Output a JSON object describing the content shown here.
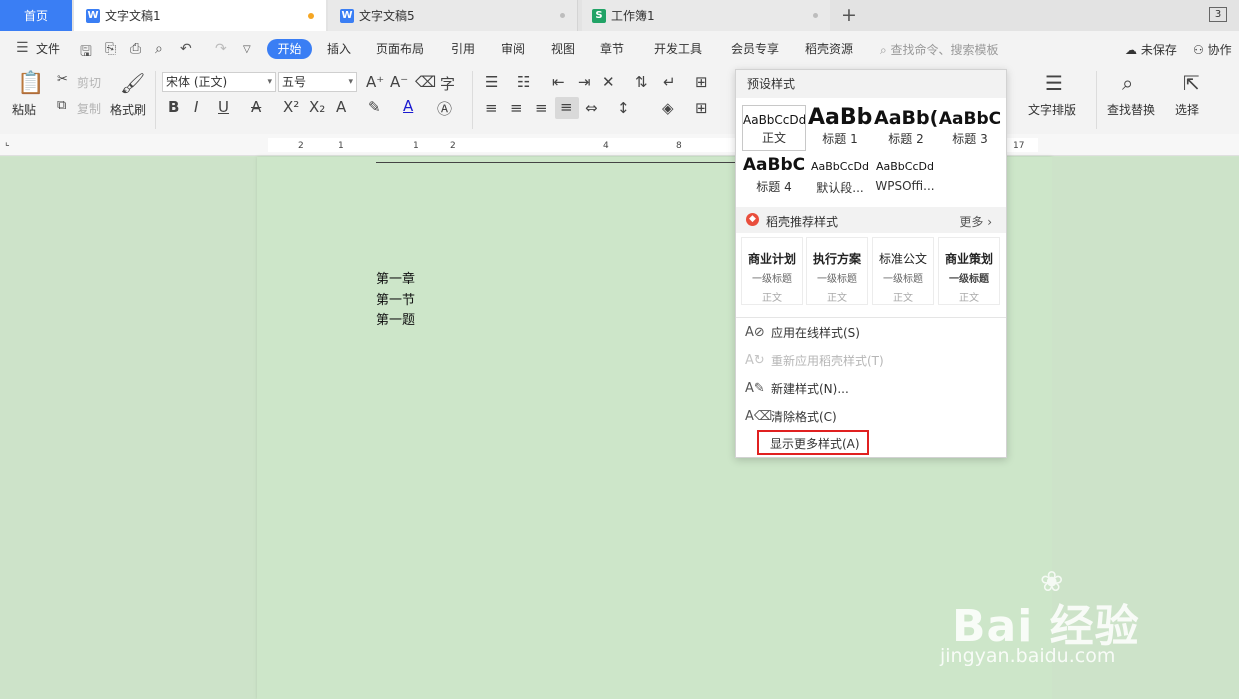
{
  "tabs": {
    "home": "首页",
    "doc1": "文字文稿1",
    "doc5": "文字文稿5",
    "sheet1": "工作簿1",
    "add": "+",
    "count": "3",
    "w_icon": "W",
    "s_icon": "S",
    "unsaved_dot_color": "#f5a623"
  },
  "menu": {
    "file": "文件",
    "start": "开始",
    "items": [
      "插入",
      "页面布局",
      "引用",
      "审阅",
      "视图",
      "章节",
      "开发工具",
      "会员专享",
      "稻壳资源"
    ],
    "search_placeholder": "查找命令、搜索模板",
    "save_status": "未保存",
    "collab": "协作"
  },
  "ribbon": {
    "paste": "粘贴",
    "cut": "剪切",
    "copy": "复制",
    "format_painter": "格式刷",
    "font_name": "宋体 (正文)",
    "font_size": "五号",
    "text_layout": "文字排版",
    "find_replace": "查找替换",
    "select": "选择"
  },
  "ruler": {
    "numbers": [
      "2",
      "1",
      "1",
      "2",
      "4",
      "6",
      "8",
      "17"
    ]
  },
  "document": {
    "lines": [
      "第一章",
      "第一节",
      "第一题"
    ]
  },
  "style_panel": {
    "preset_title": "预设样式",
    "styles": [
      {
        "sample": "AaBbCcDd",
        "name": "正文"
      },
      {
        "sample": "AaBb",
        "name": "标题 1"
      },
      {
        "sample": "AaBb(",
        "name": "标题 2"
      },
      {
        "sample": "AaBbC",
        "name": "标题 3"
      },
      {
        "sample": "AaBbC",
        "name": "标题 4"
      },
      {
        "sample": "AaBbCcDd",
        "name": "默认段..."
      },
      {
        "sample": "AaBbCcDd",
        "name": "WPSOffi..."
      }
    ],
    "recommended_title": "稻壳推荐样式",
    "more": "更多",
    "recommended": [
      {
        "title": "商业计划",
        "sub": "一级标题",
        "body": "正文"
      },
      {
        "title": "执行方案",
        "sub": "一级标题",
        "body": "正文"
      },
      {
        "title": "标准公文",
        "sub": "一级标题",
        "body": "正文"
      },
      {
        "title": "商业策划",
        "sub": "一级标题",
        "body": "正文"
      }
    ],
    "actions": [
      {
        "label": "应用在线样式(S)",
        "enabled": true
      },
      {
        "label": "重新应用稻壳样式(T)",
        "enabled": false
      },
      {
        "label": "新建样式(N)...",
        "enabled": true
      },
      {
        "label": "清除格式(C)",
        "enabled": true
      },
      {
        "label": "显示更多样式(A)",
        "enabled": true,
        "highlighted": true
      }
    ],
    "highlight_color": "#e02020"
  },
  "watermark": {
    "logo": "Bai 经验",
    "url": "jingyan.baidu.com"
  }
}
